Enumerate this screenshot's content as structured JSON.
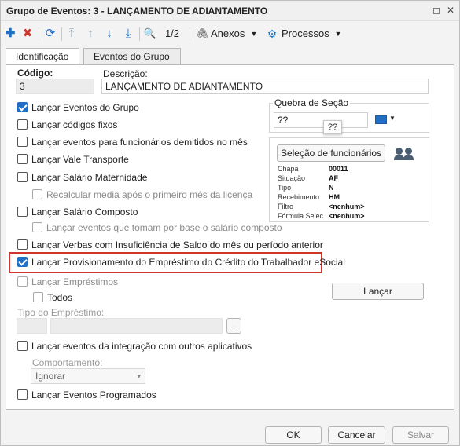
{
  "window": {
    "title": "Grupo de Eventos: 3 - LANÇAMENTO DE ADIANTAMENTO",
    "restore_glyph": "◻",
    "close_glyph": "✕"
  },
  "toolbar": {
    "add_glyph": "✚",
    "delete_glyph": "✖",
    "refresh_glyph": "⟳",
    "first_glyph": "⤒",
    "prev_glyph": "↑",
    "next_glyph": "↓",
    "last_glyph": "⤓",
    "search_glyph": "🔍",
    "page": "1/2",
    "anexos": "Anexos",
    "processos": "Processos",
    "clip_glyph": "🖇",
    "gear_glyph": "⚙",
    "dropdown_glyph": "▼"
  },
  "tabs": [
    {
      "label": "Identificação"
    },
    {
      "label": "Eventos do Grupo"
    }
  ],
  "form": {
    "codigo_label": "Código:",
    "codigo_value": "3",
    "descricao_label": "Descrição:",
    "descricao_value": "LANÇAMENTO DE ADIANTAMENTO",
    "options": [
      {
        "label": "Lançar Eventos do Grupo",
        "checked": true
      },
      {
        "label": "Lançar códigos fixos",
        "checked": false
      },
      {
        "label": "Lançar eventos para funcionários demitidos no mês",
        "checked": false
      },
      {
        "label": "Lançar Vale Transporte",
        "checked": false
      },
      {
        "label": "Lançar Salário Maternidade",
        "checked": false
      },
      {
        "label": "Recalcular media após o primeiro mês da licença",
        "checked": false
      },
      {
        "label": "Lançar Salário Composto",
        "checked": false
      },
      {
        "label": "Lançar eventos que tomam por base o salário composto",
        "checked": false
      },
      {
        "label": "Lançar Verbas com Insuficiência de Saldo do mês ou período anterior",
        "checked": false
      },
      {
        "label": "Lançar Provisionamento do Empréstimo do Crédito do Trabalhador eSocial",
        "checked": true
      },
      {
        "label": "Lançar Empréstimos",
        "checked": false
      },
      {
        "label": "Todos",
        "checked": false
      },
      {
        "label": "Lançar eventos da integração com outros aplicativos",
        "checked": false
      },
      {
        "label": "Lançar Eventos Programados",
        "checked": false
      }
    ],
    "tipo_emprestimo_label": "Tipo do Empréstimo:",
    "ellipsis": "...",
    "comportamento_label": "Comportamento:",
    "comportamento_value": "Ignorar",
    "quebra_label": "Quebra de Seção",
    "quebra_value": "??",
    "tooltip": "??",
    "selecao_button": "Seleção de funcionários",
    "info": [
      {
        "key": "Chapa",
        "value": "00011"
      },
      {
        "key": "Situação",
        "value": "AF"
      },
      {
        "key": "Tipo",
        "value": "N"
      },
      {
        "key": "Recebimento",
        "value": "HM"
      },
      {
        "key": "Filtro",
        "value": "<nenhum>"
      },
      {
        "key": "Fórmula Selec",
        "value": "<nenhum>"
      }
    ],
    "lancar_button": "Lançar"
  },
  "footer": {
    "ok": "OK",
    "cancelar": "Cancelar",
    "salvar": "Salvar"
  },
  "colors": {
    "accent": "#1f6fc5",
    "highlight": "#d0352b",
    "add": "#1f6fc5",
    "delete": "#d0352b"
  }
}
